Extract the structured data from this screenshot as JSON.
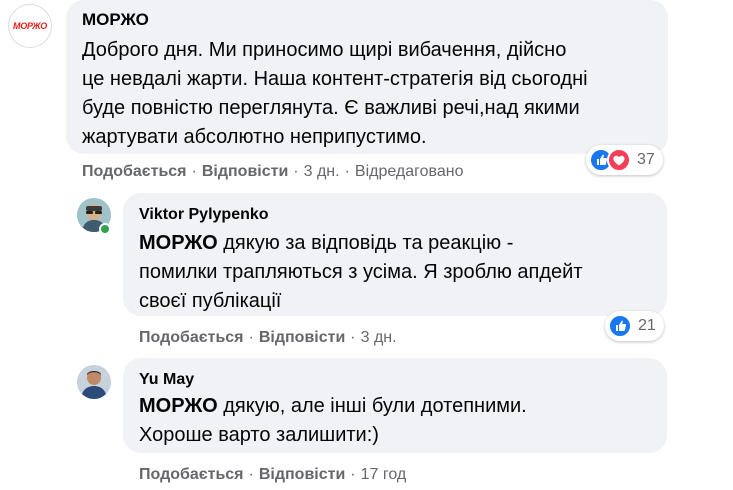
{
  "comments": [
    {
      "author": "МОРЖО",
      "avatar_logo_text": "МОРЖО",
      "lines": [
        "Доброго дня. Ми приносимо щирі вибачення, дійсно",
        "це невдалі жарти. Наша контент-стратегія від сьогодні",
        "буде повністю переглянута. Є важливі речі,над якими",
        "жартувати абсолютно неприпустимо."
      ],
      "actions": {
        "like": "Подобається",
        "reply": "Відповісти",
        "time": "3 дн.",
        "edited": "Відредаговано"
      },
      "reactions": {
        "icons": [
          "like-icon",
          "love-icon"
        ],
        "count": "37"
      }
    },
    {
      "author": "Viktor Pylypenko",
      "mention": "МОРЖО",
      "line1_rest": " дякую за відповідь та реакцію -",
      "lines": [
        "помилки трапляються з усіма. Я зроблю апдейт",
        "своєї публікації"
      ],
      "actions": {
        "like": "Подобається",
        "reply": "Відповісти",
        "time": "3 дн."
      },
      "reactions": {
        "icons": [
          "like-icon"
        ],
        "count": "21"
      }
    },
    {
      "author": "Yu May",
      "mention": "МОРЖО",
      "line1_rest": " дякую, але інші були дотепними.",
      "lines": [
        "Хороше варто залишити:)"
      ],
      "actions": {
        "like": "Подобається",
        "reply": "Відповісти",
        "time": "17 год"
      }
    }
  ],
  "colors": {
    "bubble": "#f0f2f5",
    "meta": "#65676b",
    "like_blue": "#1877f2",
    "love_red": "#f33e58",
    "brand_red": "#e2231a",
    "online": "#31a24c"
  }
}
